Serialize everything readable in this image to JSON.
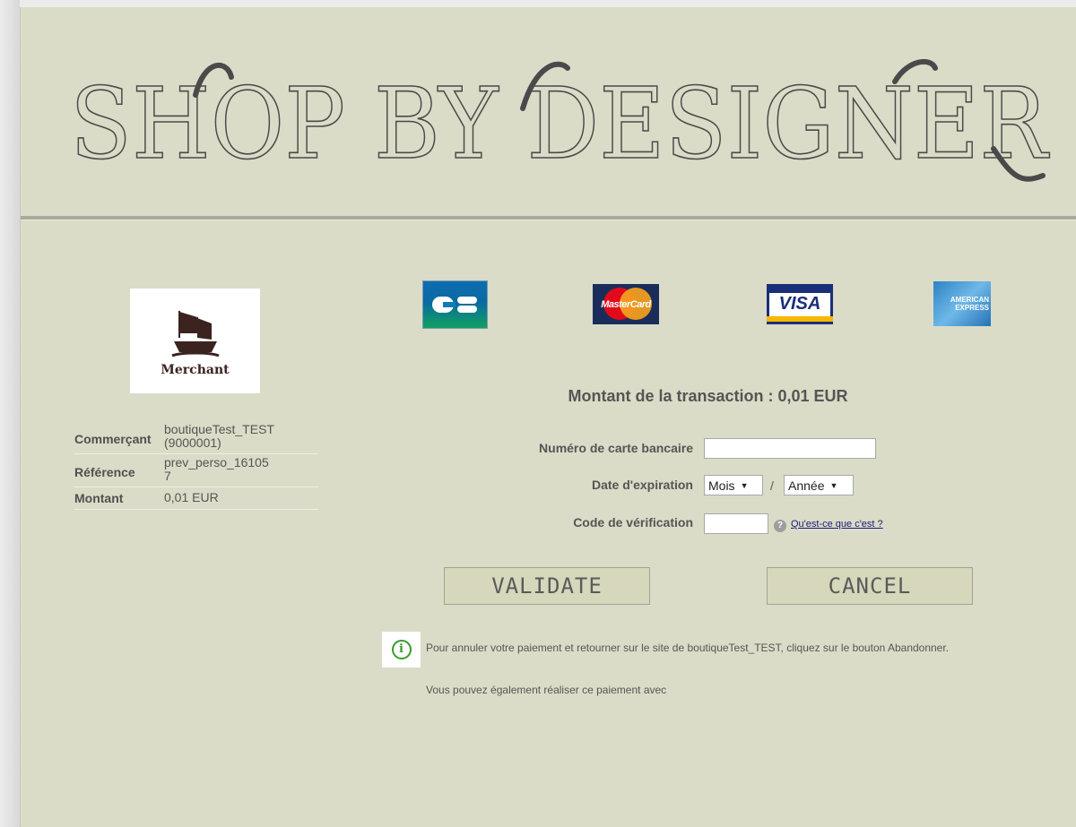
{
  "header": {
    "title": "SHOP BY DESIGNER"
  },
  "merchant": {
    "logo_label": "Merchant",
    "rows": [
      {
        "key": "Commerçant",
        "value_line1": "boutiqueTest_TEST",
        "value_line2": "(9000001)"
      },
      {
        "key": "Référence",
        "value_line1": "prev_perso_16105",
        "value_line2": "7"
      },
      {
        "key": "Montant",
        "value_line1": "0,01 EUR",
        "value_line2": ""
      }
    ]
  },
  "cards": {
    "cb_label": "CB",
    "mastercard_label": "MasterCard",
    "visa_label": "VISA",
    "amex_line1": "AMERICAN",
    "amex_line2": "EXPRESS"
  },
  "transaction": {
    "title": "Montant de la transaction : 0,01 EUR"
  },
  "form": {
    "card_number_label": "Numéro de carte bancaire",
    "card_number_value": "",
    "expiry_label": "Date d'expiration",
    "month_selected": "Mois",
    "year_selected": "Année",
    "separator": "/",
    "cvv_label": "Code de vérification",
    "cvv_value": "",
    "help_link": "Qu'est-ce que c'est ?"
  },
  "buttons": {
    "validate": "VALIDATE",
    "cancel": "CANCEL"
  },
  "notes": {
    "cancel_info": "Pour annuler votre paiement et retourner sur le site de boutiqueTest_TEST, cliquez sur le bouton Abandonner.",
    "alternative": "Vous pouvez également réaliser ce paiement avec"
  },
  "colors": {
    "background": "#dadcc7",
    "button_bg": "#d6d7bb",
    "info_green": "#3a9c2a"
  }
}
